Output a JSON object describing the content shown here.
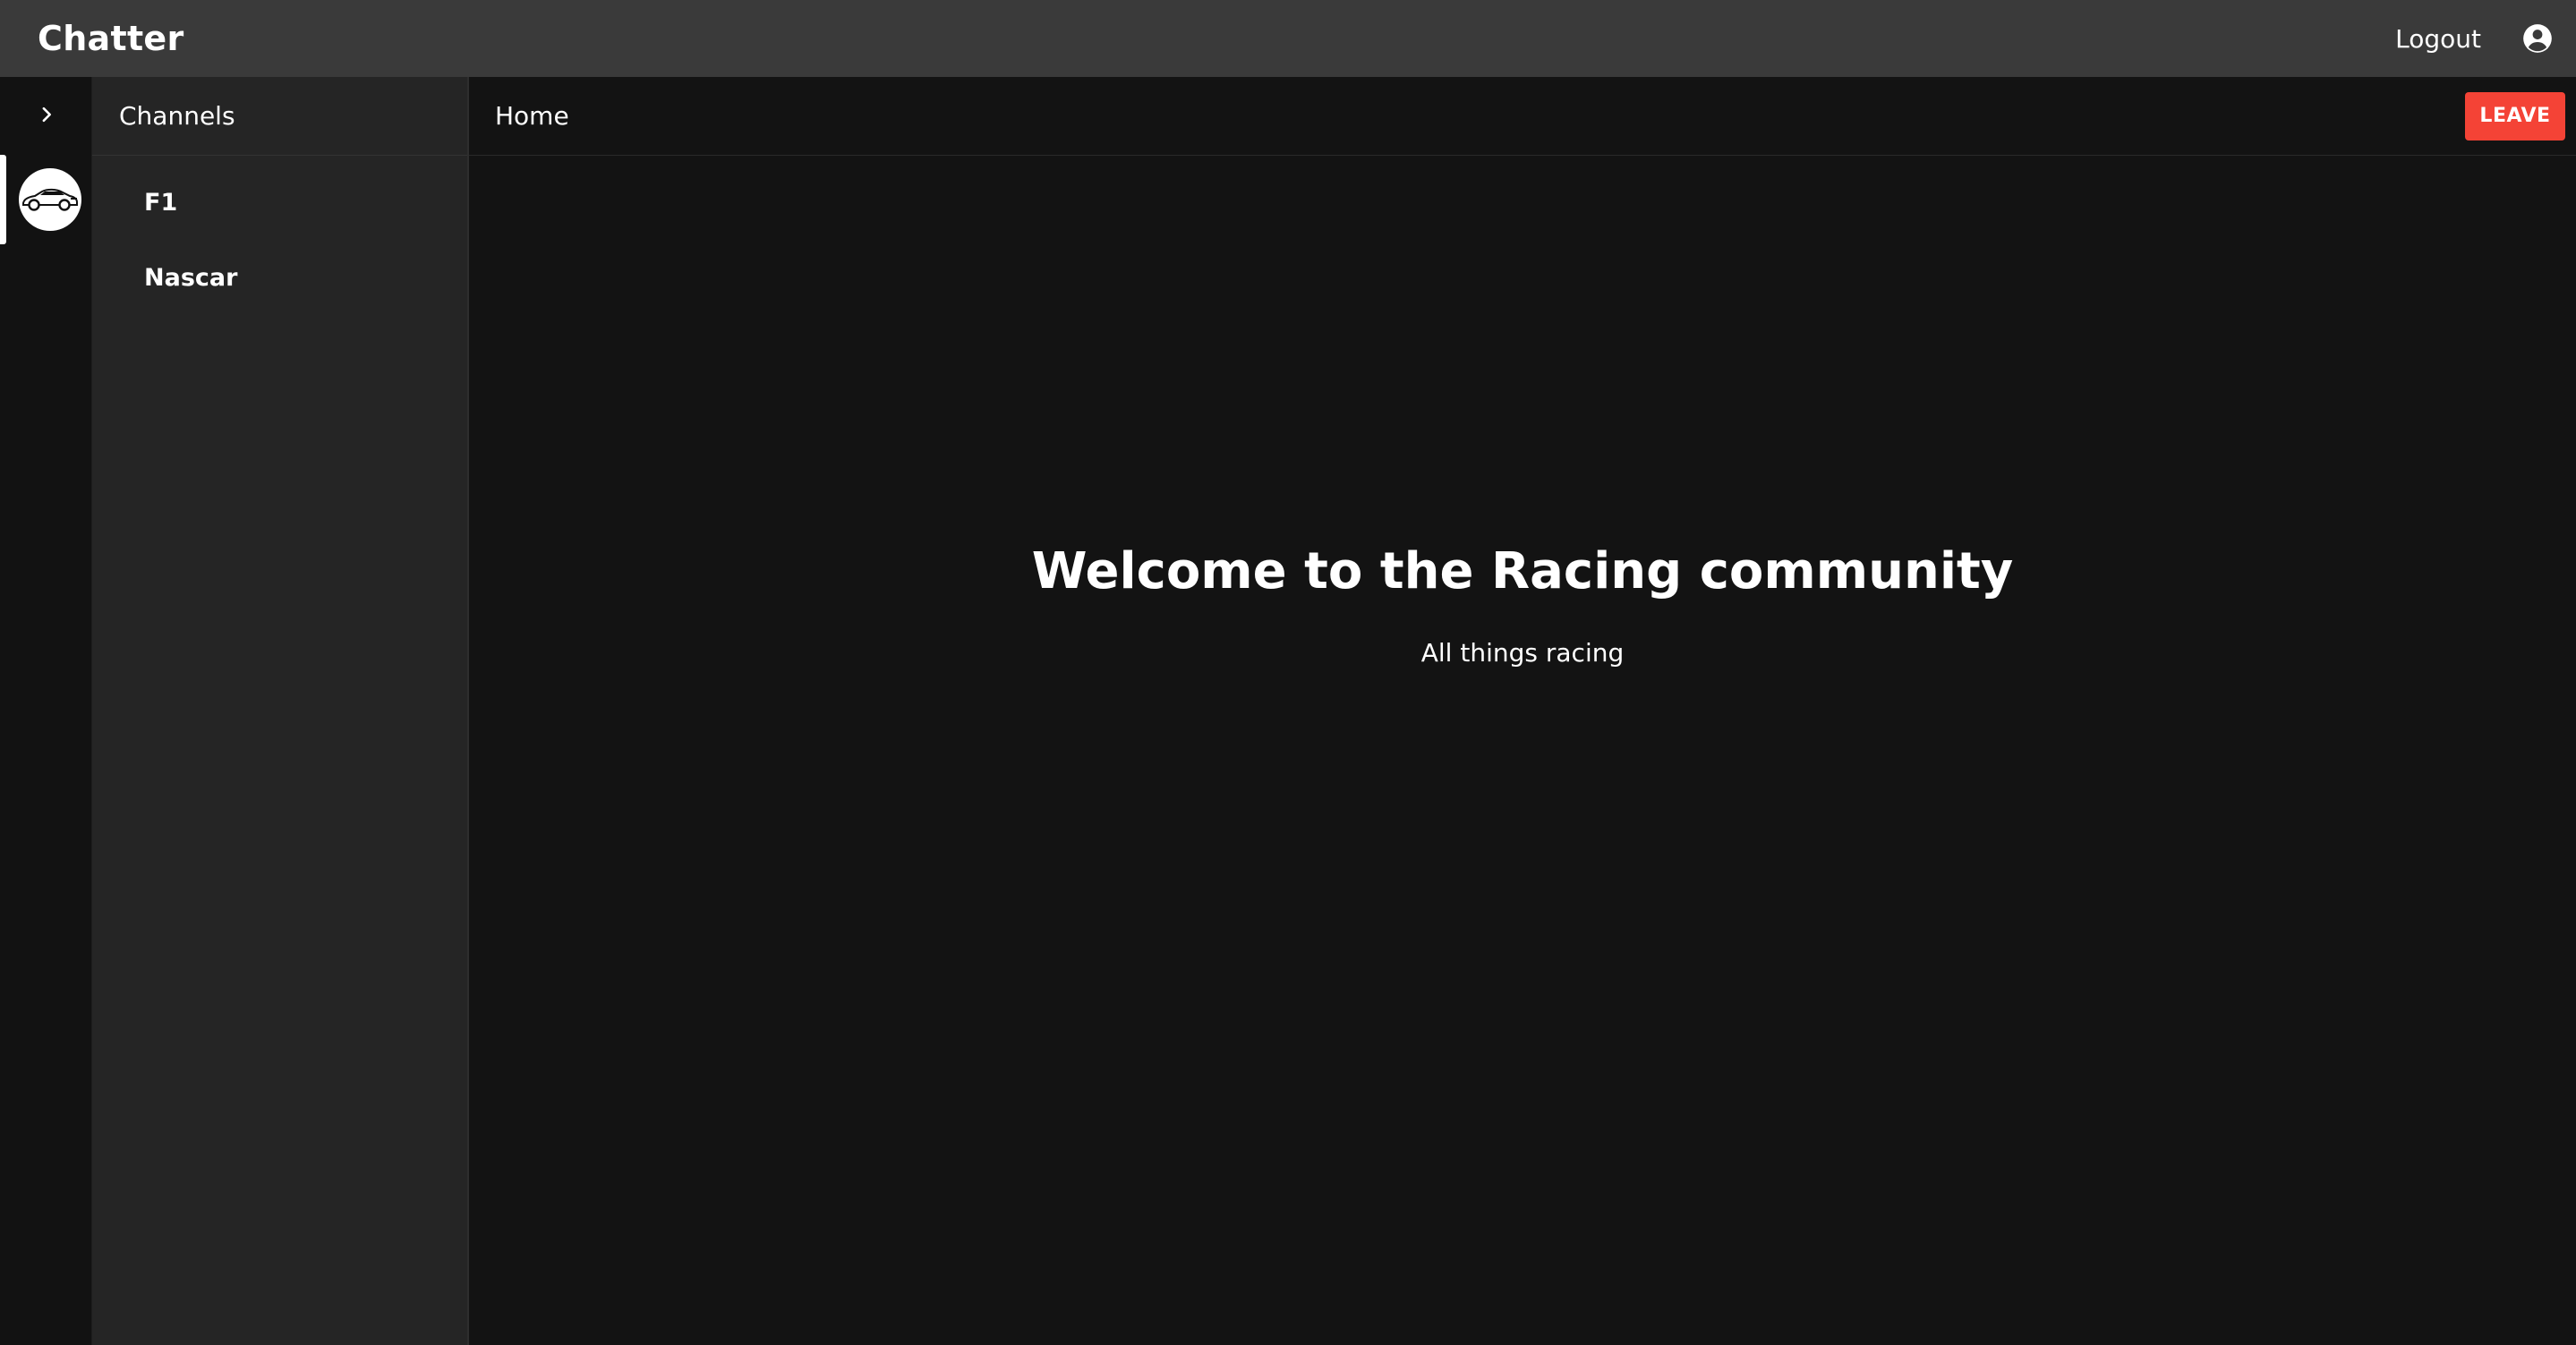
{
  "app": {
    "title": "Chatter",
    "logout_label": "Logout"
  },
  "icons": {
    "account": "account-circle-icon",
    "expand": "chevron-right-icon",
    "community": "race-car-icon"
  },
  "colors": {
    "topbar": "#3a3a3a",
    "channels_bg": "#252525",
    "main_bg": "#131313",
    "accent_danger": "#f44336"
  },
  "sidebar": {
    "header": "Channels",
    "channels": [
      {
        "label": "F1"
      },
      {
        "label": "Nascar"
      }
    ]
  },
  "main": {
    "breadcrumb": "Home",
    "leave_label": "LEAVE",
    "welcome_title": "Welcome to the Racing community",
    "welcome_subtitle": "All things racing"
  }
}
